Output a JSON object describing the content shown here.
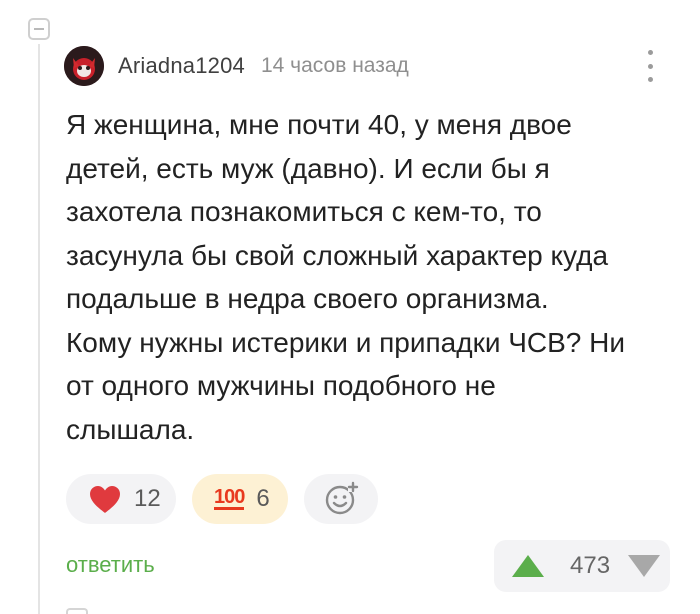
{
  "comment": {
    "author": "Ariadna1204",
    "time": "14 часов назад",
    "text": "Я женщина, мне почти 40, у меня двое\nдетей, есть муж (давно). И если бы я\nзахотела познакомиться с кем-то, то\nзасунула бы свой сложный характер куда\nподальше в недра своего организма.\nКому нужны истерики и припадки ЧСВ? Ни\nот одного мужчины подобного не\nслышала."
  },
  "reactions": [
    {
      "icon": "heart-icon",
      "count": "12",
      "color": "#e03a3e"
    },
    {
      "icon": "hundred-points-icon",
      "glyph": "100",
      "count": "6",
      "color": "#e8391e"
    }
  ],
  "actions": {
    "reply_label": "ответить",
    "rating": "473"
  },
  "colors": {
    "accent_green": "#5bae4b",
    "text": "#222222",
    "muted": "#8f8f8f"
  }
}
